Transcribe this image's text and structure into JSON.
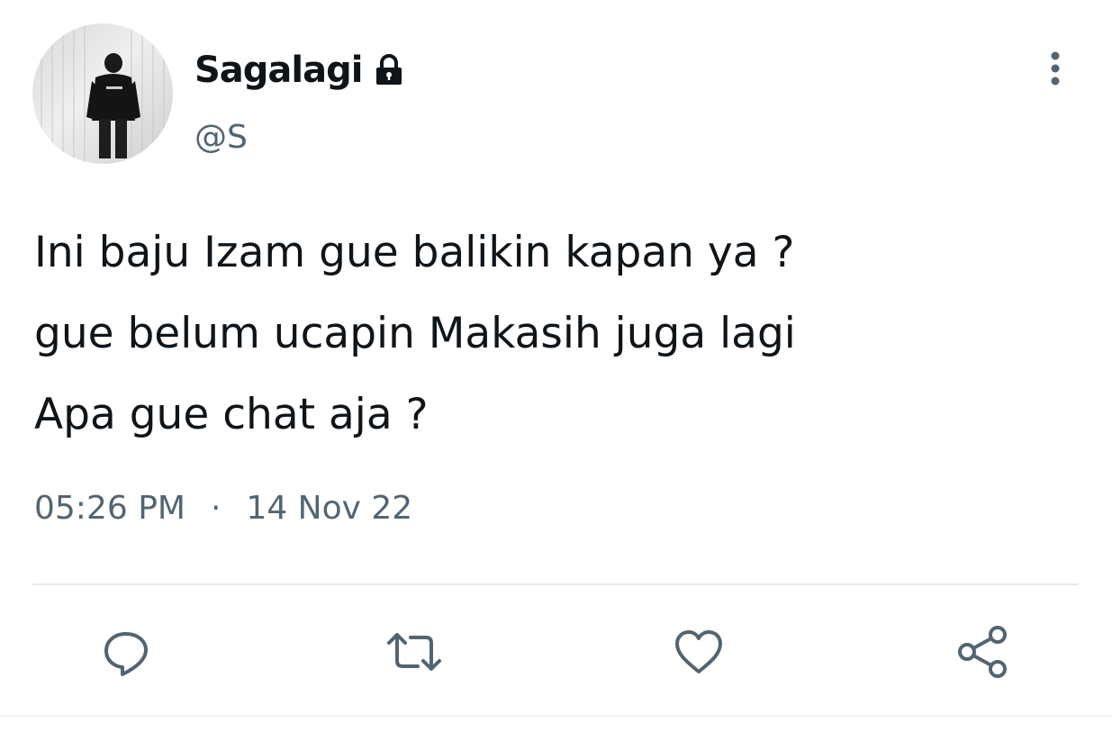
{
  "user": {
    "display_name": "Sagalagi",
    "handle": "@S",
    "avatar": "avatar-photo",
    "protected_icon": "lock-icon"
  },
  "header": {
    "more_icon": "more-vertical-icon"
  },
  "tweet": {
    "lines": [
      "Ini baju Izam gue balikin kapan ya ?",
      "gue belum ucapin Makasih juga lagi",
      "Apa gue chat aja ?"
    ],
    "time": "05:26 PM",
    "separator": "·",
    "date": "14 Nov 22"
  },
  "actions": [
    {
      "icon": "reply-icon"
    },
    {
      "icon": "retweet-icon"
    },
    {
      "icon": "like-icon"
    },
    {
      "icon": "share-icon"
    }
  ],
  "colors": {
    "text_primary": "#0f1419",
    "text_secondary": "#536471",
    "icon": "#536471",
    "divider": "#e7e9ea"
  }
}
